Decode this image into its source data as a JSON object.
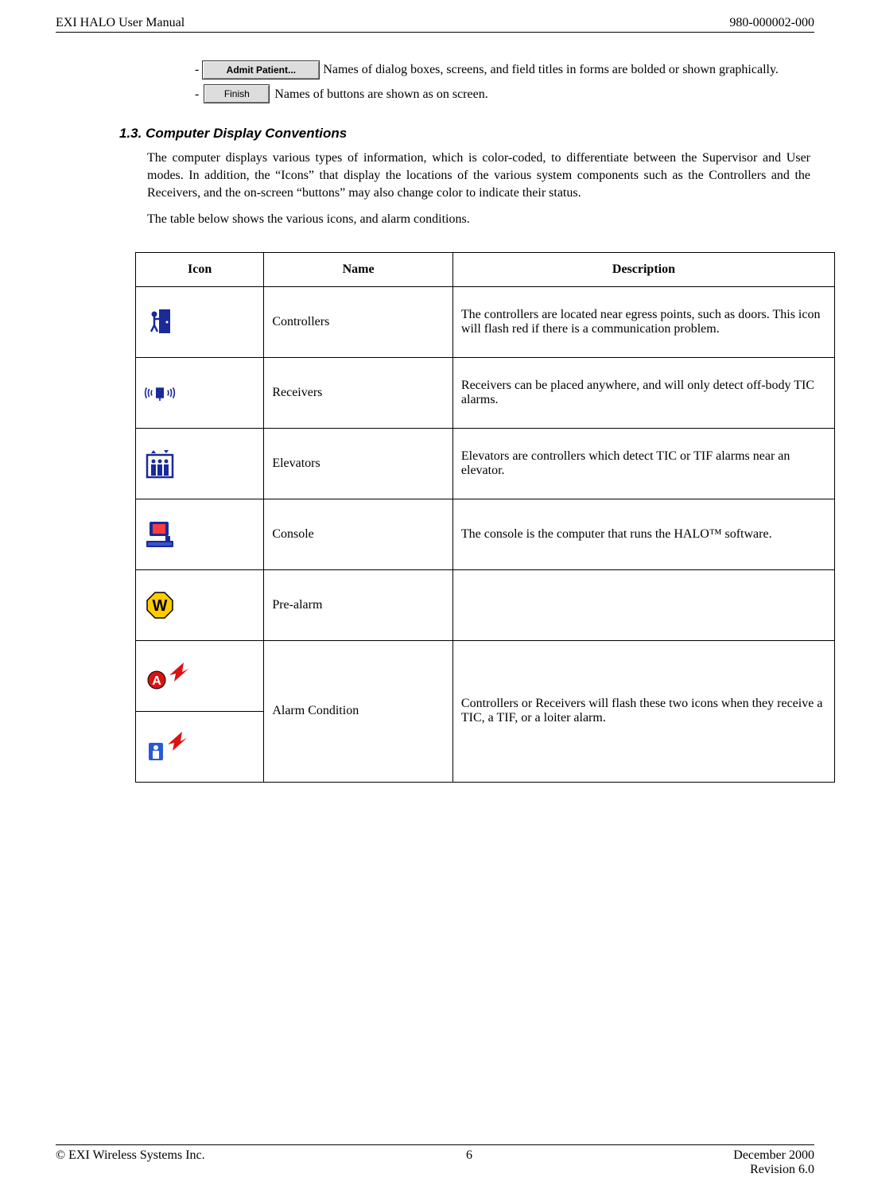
{
  "header": {
    "left": "EXI HALO User Manual",
    "right": "980-000002-000"
  },
  "conventions": {
    "admit_label": "Admit Patient...",
    "line1_tail": "  Names of dialog boxes, screens, and field titles in forms are bolded or shown graphically.",
    "dash": "-",
    "finish_label": "Finish",
    "line2_tail": "Names of buttons are shown as on screen."
  },
  "section": {
    "heading": "1.3.  Computer Display Conventions",
    "para1": "The computer displays various types of information, which is color-coded, to differentiate between the Supervisor and User modes.  In addition, the “Icons” that display the locations of the various system components such as the Controllers and the Receivers, and the on-screen “buttons” may also change color to indicate their status.",
    "para2": "The table below shows the various icons, and alarm conditions."
  },
  "table": {
    "headers": {
      "icon": "Icon",
      "name": "Name",
      "desc": "Description"
    },
    "rows": [
      {
        "name": "Controllers",
        "desc": "The controllers are located near egress points, such as doors.  This icon will flash red if there is a communication problem."
      },
      {
        "name": "Receivers",
        "desc": "Receivers can be placed anywhere, and will only detect off-body TIC alarms."
      },
      {
        "name": "Elevators",
        "desc": "Elevators are controllers which detect TIC or TIF alarms near an elevator."
      },
      {
        "name": "Console",
        "desc": "The console is the computer that runs the HALO™ software."
      },
      {
        "name": "Pre-alarm",
        "desc": ""
      },
      {
        "name": "Alarm Condition",
        "desc": "Controllers or Receivers will flash these two icons when they receive a TIC, a TIF, or a loiter alarm."
      }
    ]
  },
  "footer": {
    "left": "© EXI Wireless Systems Inc.",
    "center": "6",
    "right1": "December 2000",
    "right2": "Revision 6.0"
  }
}
